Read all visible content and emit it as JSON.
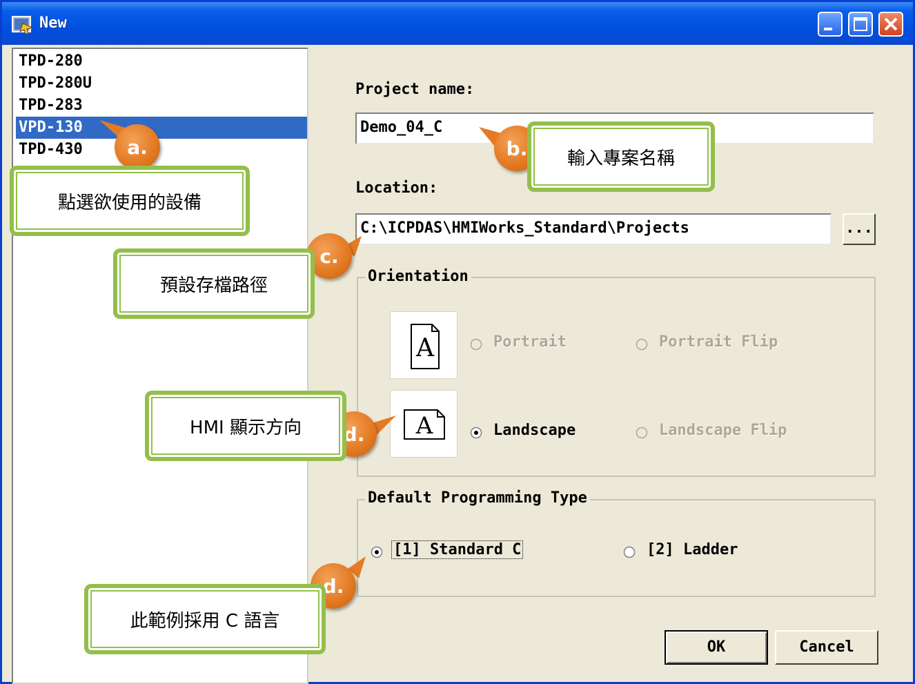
{
  "window": {
    "title": "New"
  },
  "devices": [
    "TPD-280",
    "TPD-280U",
    "TPD-283",
    "VPD-130",
    "TPD-430"
  ],
  "selected_device_index": 3,
  "project": {
    "name_label": "Project name:",
    "name_value": "Demo_04_C"
  },
  "location": {
    "label": "Location:",
    "value": "C:\\ICPDAS\\HMIWorks_Standard\\Projects",
    "browse_label": "..."
  },
  "orientation": {
    "title": "Orientation",
    "options": {
      "portrait": "Portrait",
      "portrait_flip": "Portrait Flip",
      "landscape": "Landscape",
      "landscape_flip": "Landscape Flip"
    },
    "selected": "Landscape"
  },
  "programming": {
    "title": "Default Programming Type",
    "option1": "[1] Standard C",
    "option2": "[2] Ladder",
    "selected": "[1] Standard C"
  },
  "buttons": {
    "ok": "OK",
    "cancel": "Cancel"
  },
  "annotations": {
    "a": {
      "marker": "a.",
      "text": "點選欲使用的設備"
    },
    "b": {
      "marker": "b.",
      "text": "輸入專案名稱"
    },
    "c": {
      "marker": "c.",
      "text": "預設存檔路徑"
    },
    "d1": {
      "marker": "d.",
      "text": "HMI  顯示方向"
    },
    "d2": {
      "marker": "d.",
      "text": "此範例採用  C  語言"
    }
  },
  "colors": {
    "note_border": "#93bf4a",
    "marker": "#e47b24",
    "selection": "#316ac5",
    "titlebar": "#0050e0"
  }
}
